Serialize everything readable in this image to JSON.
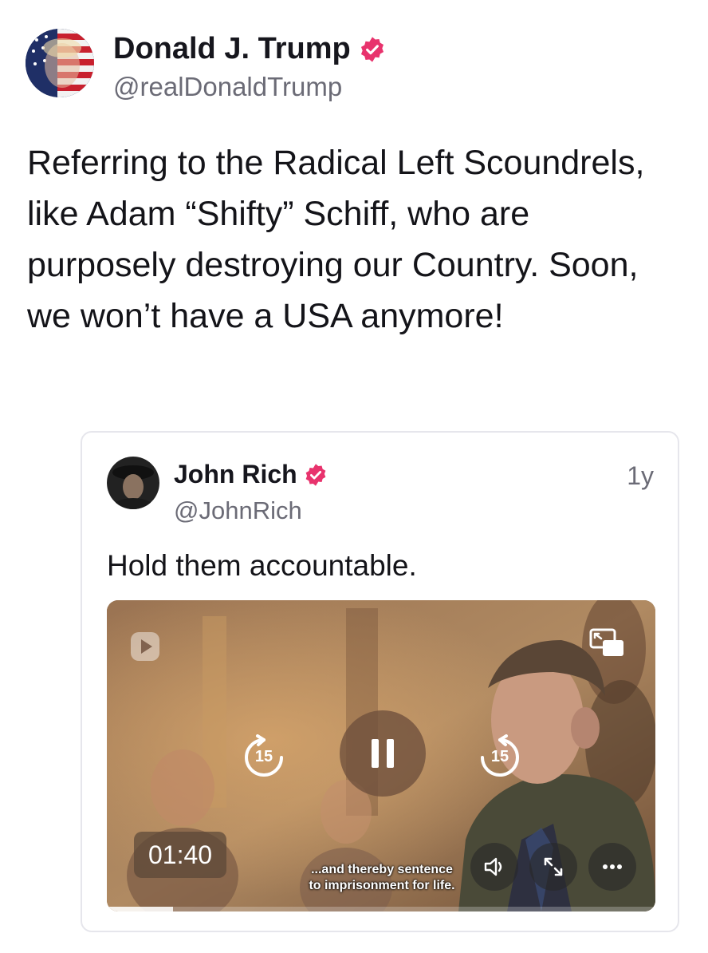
{
  "post": {
    "author_name": "Donald J. Trump",
    "author_handle": "@realDonaldTrump",
    "avatar_icon": "flag-portrait-avatar",
    "verified_icon": "verified-badge-icon",
    "text": "Referring to the Radical Left Scoundrels, like Adam “Shifty” Schiff, who are purposely destroying our Country. Soon, we won’t have a USA anymore!"
  },
  "quote": {
    "author_name": "John Rich",
    "author_handle": "@JohnRich",
    "time_ago": "1y",
    "text": "Hold them accountable.",
    "video": {
      "rewind_seconds": "15",
      "forward_seconds": "15",
      "current_time": "01:40",
      "caption_line1": "...and thereby sentence",
      "caption_line2": "to imprisonment for life.",
      "progress_fraction": 0.12,
      "icons": [
        "logo-play-icon",
        "picture-in-picture-icon",
        "rewind-15-icon",
        "pause-icon",
        "forward-15-icon",
        "volume-icon",
        "expand-icon",
        "more-icon"
      ]
    }
  },
  "colors": {
    "verified_badge": "#e8336d",
    "handle_text": "#6b6b76",
    "card_border": "#e6e6ec"
  }
}
